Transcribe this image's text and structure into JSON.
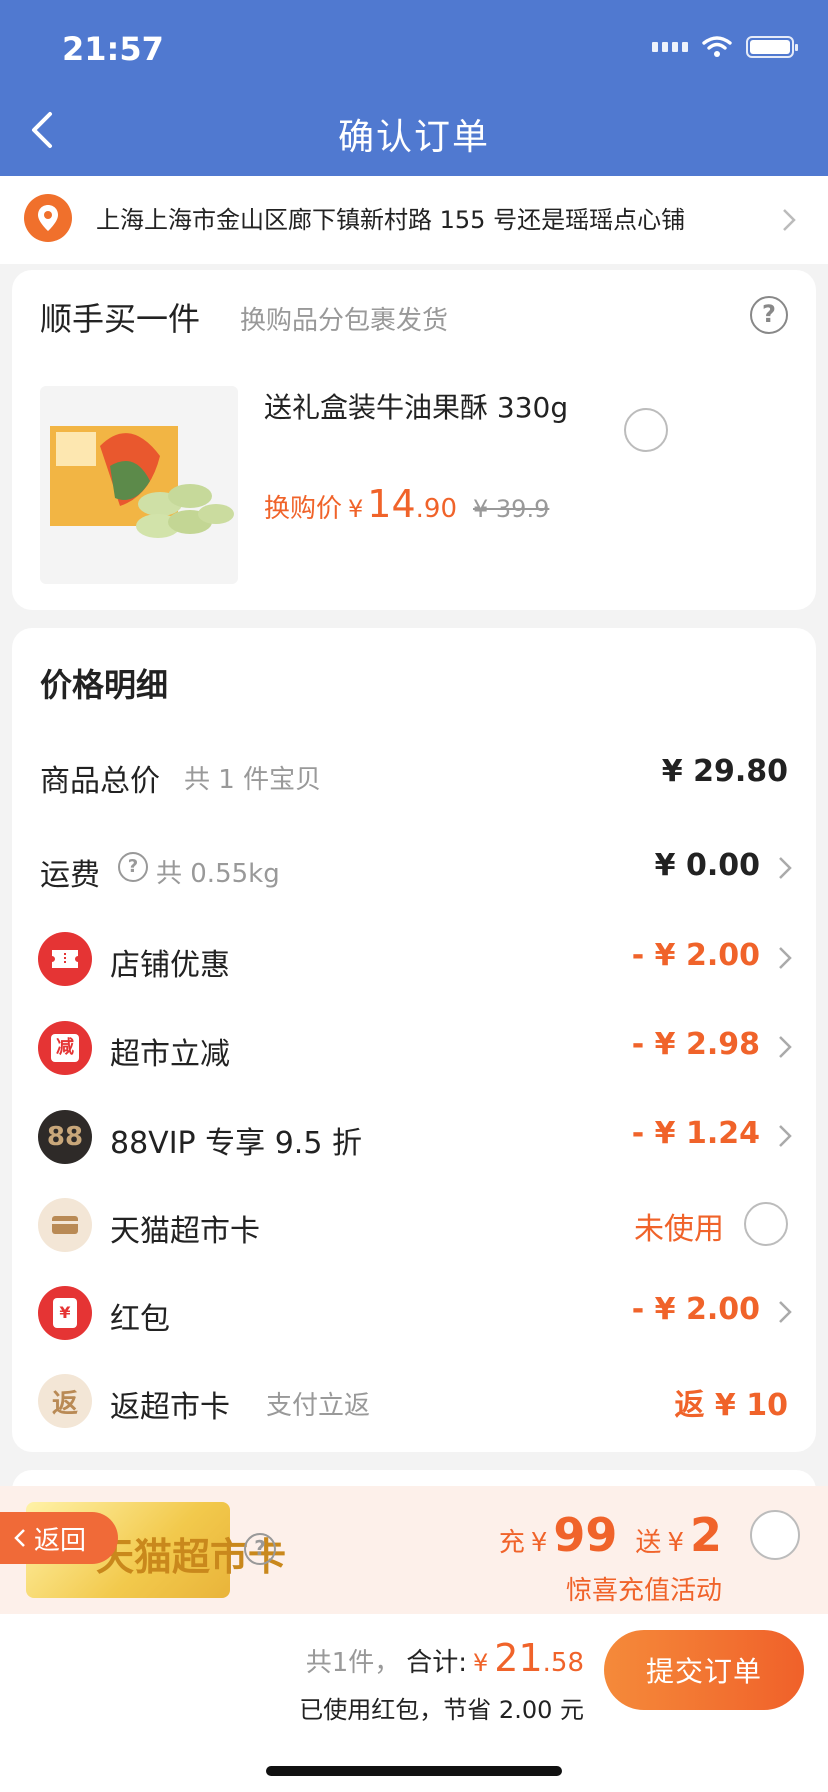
{
  "status_bar": {
    "time": "21:57"
  },
  "header": {
    "title": "确认订单"
  },
  "address": {
    "text": "上海上海市金山区廊下镇新村路 155 号还是瑶瑶点心铺"
  },
  "addon": {
    "title": "顺手买一件",
    "subtitle": "换购品分包裹发货",
    "help": "?",
    "product": {
      "name": "送礼盒装牛油果酥 330g",
      "price_label": "换购价",
      "currency": "¥",
      "price_int": "14",
      "price_dec": ".90",
      "original_price": "¥ 39.9"
    }
  },
  "price_detail": {
    "title": "价格明细",
    "rows": [
      {
        "label": "商品总价",
        "sub": "共 1 件宝贝",
        "value": "¥ 29.80"
      },
      {
        "label": "运费",
        "help": "?",
        "sub": "共 0.55kg",
        "value": "¥ 0.00"
      },
      {
        "label": "店铺优惠",
        "value": "- ¥ 2.00",
        "icon": "coupon-icon"
      },
      {
        "label": "超市立减",
        "value": "- ¥ 2.98",
        "icon": "discount-icon",
        "icon_text": "减"
      },
      {
        "label": "88VIP 专享 9.5 折",
        "value": "- ¥ 1.24",
        "icon": "vip88-icon",
        "icon_text": "88"
      },
      {
        "label": "天猫超市卡",
        "value": "未使用",
        "icon": "card-icon"
      },
      {
        "label": "红包",
        "value": "- ¥ 2.00",
        "icon": "red-envelope-icon",
        "icon_text": "¥"
      },
      {
        "label": "返超市卡",
        "sub": "支付立返",
        "value": "返 ¥ 10",
        "icon": "return-icon",
        "icon_text": "返"
      }
    ]
  },
  "promo": {
    "card_text": "天猫超市卡",
    "help": "?",
    "return_label": "返回",
    "charge_label": "充",
    "charge_yen": "¥",
    "charge_amount": "99",
    "gift_label": "送",
    "gift_yen": "¥",
    "gift_amount": "2",
    "subtitle": "惊喜充值活动"
  },
  "footer": {
    "count": "共1件，",
    "total_label": "合计:",
    "currency": "¥",
    "total_int": "21",
    "total_dec": ".58",
    "saved": "已使用红包，节省 2.00 元",
    "submit": "提交订单"
  },
  "colors": {
    "header": "#5079d0",
    "accent": "#f0632a",
    "red": "#e53434"
  }
}
